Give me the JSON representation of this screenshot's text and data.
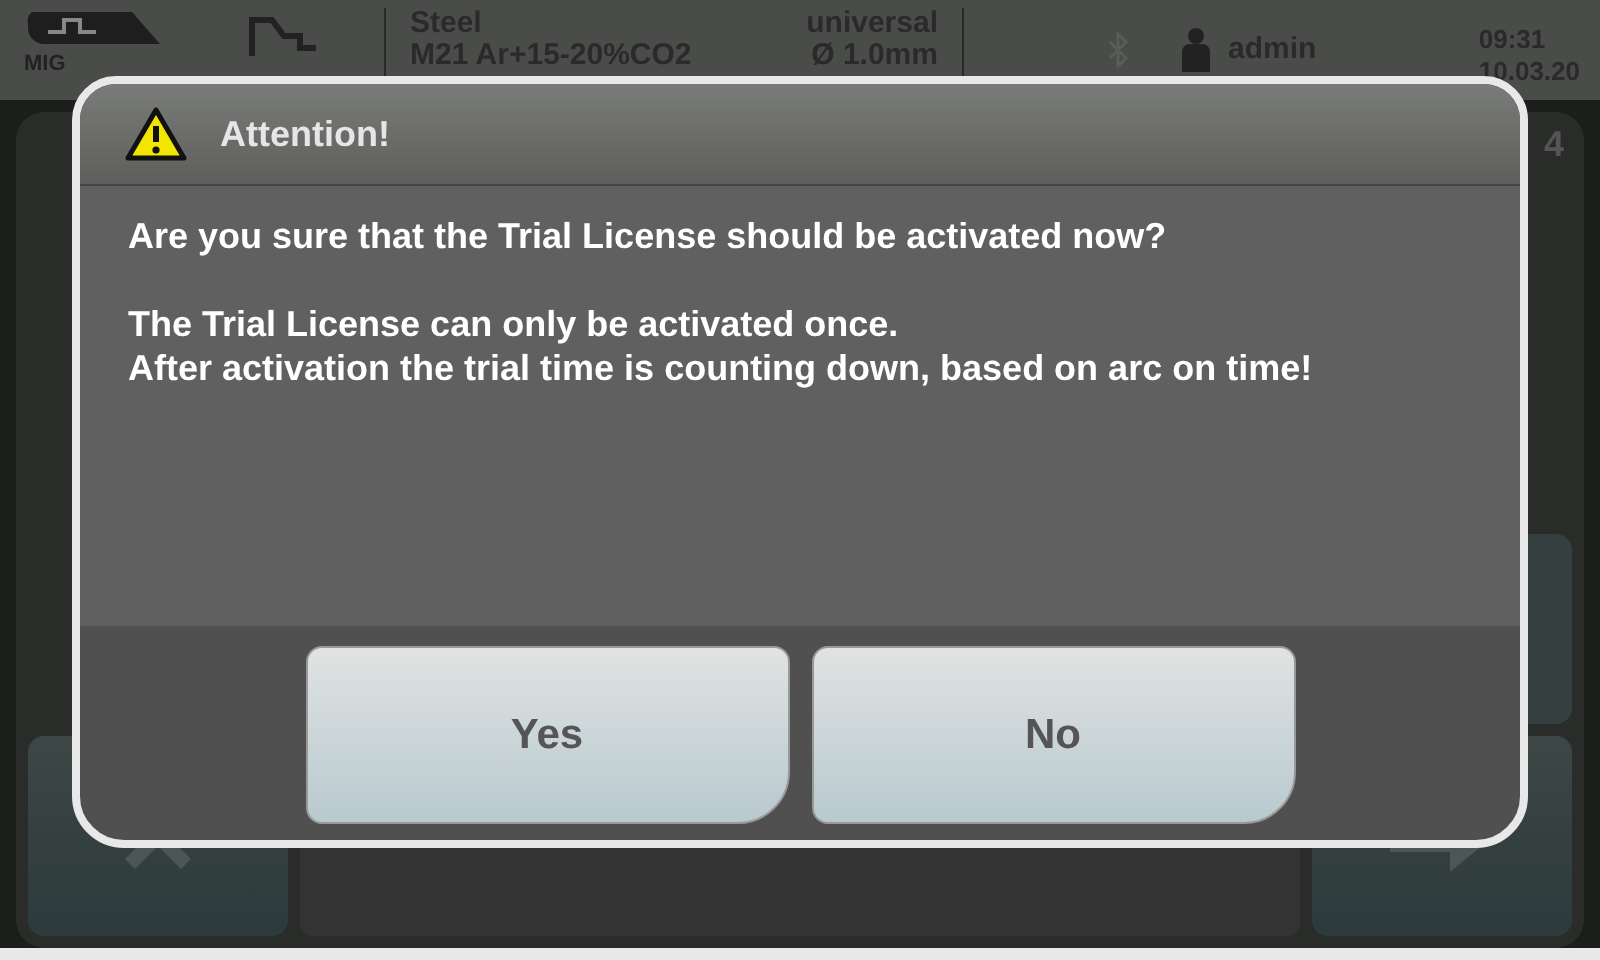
{
  "status_bar": {
    "mode": "MIG",
    "material": "Steel",
    "gas": "M21 Ar+15-20%CO2",
    "wire_type": "universal",
    "wire_diameter": "Ø 1.0mm",
    "user": "admin",
    "time": "09:31",
    "date": "10.03.20"
  },
  "background": {
    "page_number": "4"
  },
  "dialog": {
    "title": "Attention!",
    "question": "Are you sure that the Trial License should be activated now?",
    "lines": [
      "The Trial License can only be activated once.",
      "After activation the trial time is counting down, based on arc on time!"
    ],
    "buttons": [
      {
        "label": "Yes"
      },
      {
        "label": "No"
      }
    ]
  }
}
